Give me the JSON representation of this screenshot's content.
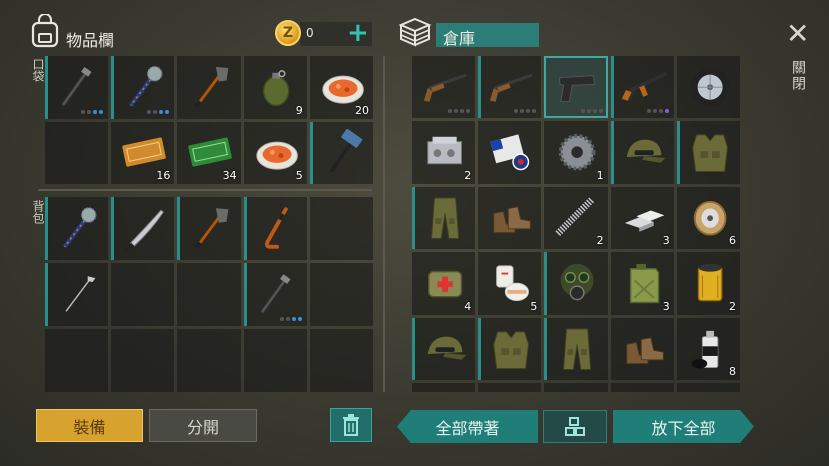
{
  "inventory": {
    "title": "物品欄",
    "coins": "0",
    "coin_symbol": "Z",
    "plus_symbol": "+",
    "pocket_label": "口袋",
    "backpack_label": "背包",
    "pockets": [
      {
        "item": "tonfa-icon",
        "qty": "",
        "dura": 2,
        "rarity": "teal"
      },
      {
        "item": "spiked-mace-icon",
        "qty": "",
        "dura": 2,
        "rarity": "teal"
      },
      {
        "item": "shovel-icon",
        "qty": "",
        "dura": 0,
        "rarity": ""
      },
      {
        "item": "grenade-icon",
        "qty": "9",
        "dura": 0,
        "rarity": ""
      },
      {
        "item": "food-plate-icon",
        "qty": "20",
        "dura": 0,
        "rarity": ""
      },
      {
        "item": "",
        "qty": "",
        "dura": 0,
        "rarity": ""
      },
      {
        "item": "coupon-orange-icon",
        "qty": "16",
        "dura": 0,
        "rarity": ""
      },
      {
        "item": "coupon-green-icon",
        "qty": "34",
        "dura": 0,
        "rarity": ""
      },
      {
        "item": "food-plate-icon",
        "qty": "5",
        "dura": 0,
        "rarity": ""
      },
      {
        "item": "sledgehammer-icon",
        "qty": "",
        "dura": 0,
        "rarity": "teal"
      }
    ],
    "backpack": [
      {
        "item": "spiked-mace-icon",
        "qty": "",
        "dura": 0,
        "rarity": "teal"
      },
      {
        "item": "machete-icon",
        "qty": "",
        "dura": 0,
        "rarity": "teal"
      },
      {
        "item": "shovel-icon",
        "qty": "",
        "dura": 0,
        "rarity": "teal"
      },
      {
        "item": "hockey-stick-icon",
        "qty": "",
        "dura": 0,
        "rarity": "teal"
      },
      {
        "item": "",
        "qty": "",
        "dura": 0,
        "rarity": ""
      },
      {
        "item": "golf-club-icon",
        "qty": "",
        "dura": 0,
        "rarity": "teal"
      },
      {
        "item": "",
        "qty": "",
        "dura": 0,
        "rarity": ""
      },
      {
        "item": "",
        "qty": "",
        "dura": 0,
        "rarity": ""
      },
      {
        "item": "tonfa-icon",
        "qty": "",
        "dura": 2,
        "rarity": "teal"
      },
      {
        "item": "",
        "qty": "",
        "dura": 0,
        "rarity": ""
      },
      {
        "item": "",
        "qty": "",
        "dura": 0,
        "rarity": ""
      },
      {
        "item": "",
        "qty": "",
        "dura": 0,
        "rarity": ""
      },
      {
        "item": "",
        "qty": "",
        "dura": 0,
        "rarity": ""
      },
      {
        "item": "",
        "qty": "",
        "dura": 0,
        "rarity": ""
      },
      {
        "item": "",
        "qty": "",
        "dura": 0,
        "rarity": ""
      }
    ]
  },
  "storage": {
    "title": "倉庫",
    "close_label": "關閉",
    "close_symbol": "✕",
    "items": [
      {
        "item": "shotgun-icon",
        "qty": "",
        "dura": 0,
        "rarity": ""
      },
      {
        "item": "shotgun-icon",
        "qty": "",
        "dura": 0,
        "rarity": "teal"
      },
      {
        "item": "pistol-icon",
        "qty": "",
        "dura": 0,
        "rarity": "",
        "selected": true
      },
      {
        "item": "assault-rifle-icon",
        "qty": "",
        "dura": 0,
        "rarity": "purple"
      },
      {
        "item": "wheel-icon",
        "qty": "",
        "dura": 0,
        "rarity": ""
      },
      {
        "item": "engine-block-icon",
        "qty": "2",
        "dura": 0,
        "rarity": ""
      },
      {
        "item": "flag-badge-icon",
        "qty": "",
        "dura": 0,
        "rarity": ""
      },
      {
        "item": "gear-icon",
        "qty": "1",
        "dura": 0,
        "rarity": ""
      },
      {
        "item": "military-cap-icon",
        "qty": "",
        "dura": 0,
        "rarity": "teal"
      },
      {
        "item": "military-vest-icon",
        "qty": "",
        "dura": 0,
        "rarity": "teal"
      },
      {
        "item": "military-pants-icon",
        "qty": "",
        "dura": 0,
        "rarity": "teal"
      },
      {
        "item": "boots-icon",
        "qty": "",
        "dura": 0,
        "rarity": ""
      },
      {
        "item": "spring-icon",
        "qty": "2",
        "dura": 0,
        "rarity": ""
      },
      {
        "item": "metal-bars-icon",
        "qty": "3",
        "dura": 0,
        "rarity": ""
      },
      {
        "item": "wire-spool-icon",
        "qty": "6",
        "dura": 0,
        "rarity": ""
      },
      {
        "item": "medkit-bag-icon",
        "qty": "4",
        "dura": 0,
        "rarity": ""
      },
      {
        "item": "bandage-icon",
        "qty": "5",
        "dura": 0,
        "rarity": ""
      },
      {
        "item": "gas-mask-icon",
        "qty": "",
        "dura": 0,
        "rarity": "teal"
      },
      {
        "item": "jerrycan-icon",
        "qty": "3",
        "dura": 0,
        "rarity": ""
      },
      {
        "item": "oil-filter-icon",
        "qty": "2",
        "dura": 0,
        "rarity": ""
      },
      {
        "item": "military-cap-icon",
        "qty": "",
        "dura": 0,
        "rarity": "teal"
      },
      {
        "item": "military-vest-icon",
        "qty": "",
        "dura": 0,
        "rarity": "teal"
      },
      {
        "item": "military-pants-icon",
        "qty": "",
        "dura": 0,
        "rarity": "teal"
      },
      {
        "item": "boots-icon",
        "qty": "",
        "dura": 0,
        "rarity": ""
      },
      {
        "item": "spray-can-icon",
        "qty": "8",
        "dura": 0,
        "rarity": ""
      }
    ]
  },
  "buttons": {
    "equip": "裝備",
    "split": "分開",
    "take_all": "全部帶著",
    "drop_all": "放下全部"
  },
  "colors": {
    "accent_teal": "#1f7e78",
    "equip_gold": "#d7a22e",
    "coin_gold": "#d89a1a"
  }
}
